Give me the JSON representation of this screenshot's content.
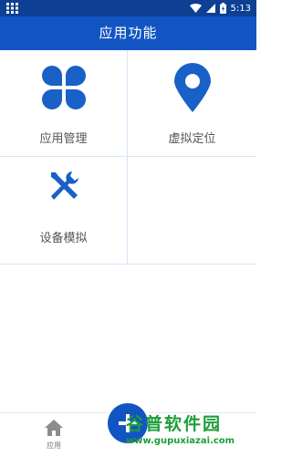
{
  "status_bar": {
    "time": "5:13"
  },
  "app_bar": {
    "title": "应用功能"
  },
  "tiles": [
    {
      "label": "应用管理",
      "icon": "four-petal-icon"
    },
    {
      "label": "虚拟定位",
      "icon": "location-pin-icon"
    },
    {
      "label": "设备模拟",
      "icon": "wrench-screwdriver-icon"
    }
  ],
  "bottom_nav": {
    "home_label": "应用"
  },
  "watermark": {
    "title": "谷普软件园",
    "url": "www.gupuxiazai.com"
  },
  "colors": {
    "primary": "#1255c2",
    "status_bar": "#0d3f93",
    "icon": "#1960c7",
    "divider": "#d7e6f6",
    "watermark": "#1e9e3a"
  }
}
